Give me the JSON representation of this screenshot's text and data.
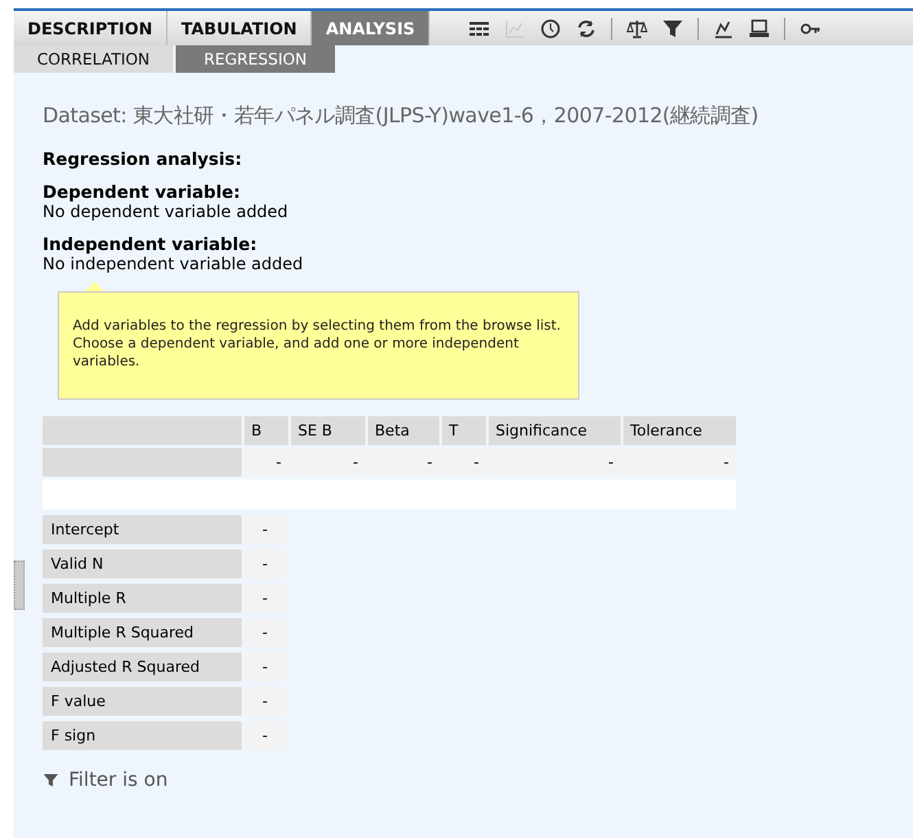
{
  "tabs": [
    {
      "label": "DESCRIPTION",
      "selected": false
    },
    {
      "label": "TABULATION",
      "selected": false
    },
    {
      "label": "ANALYSIS",
      "selected": true
    }
  ],
  "subtabs": [
    {
      "label": "CORRELATION",
      "selected": false
    },
    {
      "label": "REGRESSION",
      "selected": true
    }
  ],
  "toolbar": [
    {
      "kind": "table",
      "disabled": false
    },
    {
      "kind": "chart",
      "disabled": true
    },
    {
      "kind": "clock",
      "disabled": false
    },
    {
      "kind": "refresh",
      "disabled": false
    },
    {
      "kind": "sep"
    },
    {
      "kind": "scales",
      "disabled": false
    },
    {
      "kind": "filter",
      "disabled": false
    },
    {
      "kind": "sep"
    },
    {
      "kind": "graph",
      "disabled": false
    },
    {
      "kind": "print",
      "disabled": false
    },
    {
      "kind": "sep"
    },
    {
      "kind": "key",
      "disabled": false
    }
  ],
  "dataset": "Dataset: 東大社研・若年パネル調査(JLPS-Y)wave1-6，2007-2012(継続調査)",
  "title": "Regression analysis:",
  "dependent": {
    "label": "Dependent variable:",
    "value": "No dependent variable added"
  },
  "independent": {
    "label": "Independent variable:",
    "value": "No independent variable added"
  },
  "tooltip": "Add variables to the regression by selecting them from the browse list. Choose a dependent variable, and add one or more independent variables.",
  "table": {
    "columns": [
      "B",
      "SE B",
      "Beta",
      "T",
      "Significance",
      "Tolerance"
    ],
    "rows": [
      {
        "values": [
          "-",
          "-",
          "-",
          "-",
          "-",
          "-"
        ]
      }
    ]
  },
  "stats": [
    {
      "label": "Intercept",
      "value": "-"
    },
    {
      "label": "Valid N",
      "value": "-"
    },
    {
      "label": "Multiple R",
      "value": "-"
    },
    {
      "label": "Multiple R Squared",
      "value": "-"
    },
    {
      "label": "Adjusted R Squared",
      "value": "-"
    },
    {
      "label": "F value",
      "value": "-"
    },
    {
      "label": "F sign",
      "value": "-"
    }
  ],
  "filter_note": "Filter is on"
}
